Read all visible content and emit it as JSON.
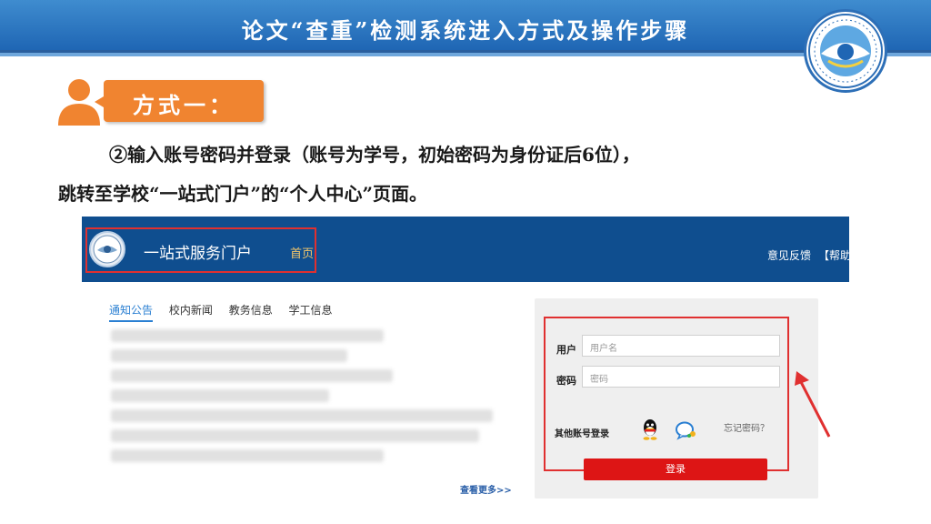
{
  "slide": {
    "title": "论文“查重”检测系统进入方式及操作步骤",
    "method_label": "方式一：",
    "description_line1": "②输入账号密码并登录（账号为学号，初始密码为身份证后6位），",
    "description_line2": "跳转至学校“一站式门户”的“个人中心”页面。"
  },
  "portal": {
    "name": "一站式服务门户",
    "home": "首页",
    "feedback": "意见反馈",
    "help": "【帮助】",
    "news_tabs": [
      "通知公告",
      "校内新闻",
      "教务信息",
      "学工信息"
    ],
    "see_more": "查看更多>>"
  },
  "login": {
    "user_label": "用户",
    "user_placeholder": "用户名",
    "password_label": "密码",
    "password_placeholder": "密码",
    "other_login": "其他账号登录",
    "forgot": "忘记密码？",
    "submit": "登录"
  },
  "icons": {
    "person": "person-icon",
    "qq": "qq-icon",
    "wechat": "wechat-icon",
    "logo": "school-logo"
  },
  "colors": {
    "title_bar": "#1f66b4",
    "method_tag": "#f08430",
    "portal_header": "#0f4e8f",
    "highlight": "#e03030",
    "login_button": "#dd1515"
  }
}
